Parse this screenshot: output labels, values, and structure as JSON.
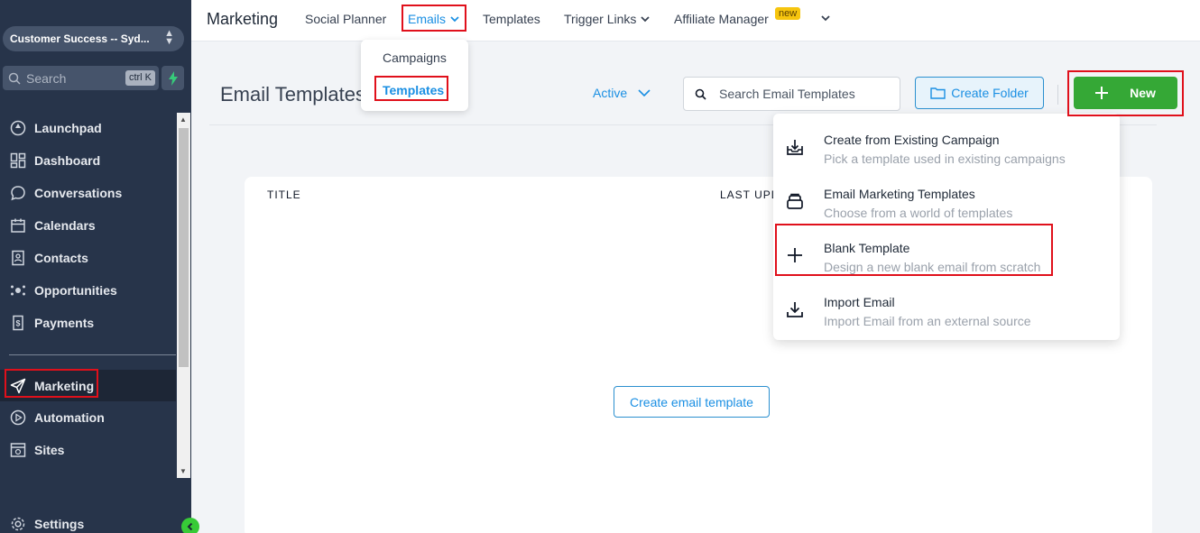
{
  "sidebar": {
    "account": "Customer Success -- Syd...",
    "search_placeholder": "Search",
    "search_shortcut": "ctrl K",
    "items": [
      {
        "label": "Launchpad",
        "icon": "launchpad-icon"
      },
      {
        "label": "Dashboard",
        "icon": "dashboard-icon"
      },
      {
        "label": "Conversations",
        "icon": "chat-icon"
      },
      {
        "label": "Calendars",
        "icon": "calendar-icon"
      },
      {
        "label": "Contacts",
        "icon": "contacts-icon"
      },
      {
        "label": "Opportunities",
        "icon": "opportunities-icon"
      },
      {
        "label": "Payments",
        "icon": "payments-icon"
      },
      {
        "label": "Marketing",
        "icon": "send-icon",
        "active": true
      },
      {
        "label": "Automation",
        "icon": "automation-icon"
      },
      {
        "label": "Sites",
        "icon": "sites-icon"
      },
      {
        "label": "Settings",
        "icon": "gear-icon"
      }
    ]
  },
  "topbar": {
    "title": "Marketing",
    "tabs": [
      {
        "label": "Social Planner"
      },
      {
        "label": "Emails",
        "active": true
      },
      {
        "label": "Templates"
      },
      {
        "label": "Trigger Links"
      },
      {
        "label": "Affiliate Manager",
        "badge": "new"
      }
    ]
  },
  "emails_menu": {
    "items": [
      {
        "label": "Campaigns"
      },
      {
        "label": "Templates",
        "selected": true
      }
    ]
  },
  "page": {
    "title": "Email Templates",
    "filter": "Active",
    "search_placeholder": "Search Email Templates",
    "create_folder": "Create Folder",
    "new_button": "New"
  },
  "table": {
    "columns": [
      "TITLE",
      "LAST UPD"
    ],
    "empty_cta": "Create email template"
  },
  "new_menu": {
    "items": [
      {
        "title": "Create from Existing Campaign",
        "desc": "Pick a template used in existing campaigns",
        "icon": "inbox-download-icon"
      },
      {
        "title": "Email Marketing Templates",
        "desc": "Choose from a world of templates",
        "icon": "template-stack-icon"
      },
      {
        "title": "Blank Template",
        "desc": "Design a new blank email from scratch",
        "icon": "plus-icon"
      },
      {
        "title": "Import Email",
        "desc": "Import Email from an external source",
        "icon": "download-icon"
      }
    ]
  },
  "colors": {
    "sidebar_bg": "#27344a",
    "accent": "#1a8fe3",
    "primary_button": "#35a836",
    "highlight_box": "#e0101b",
    "badge": "#f6c50e"
  }
}
